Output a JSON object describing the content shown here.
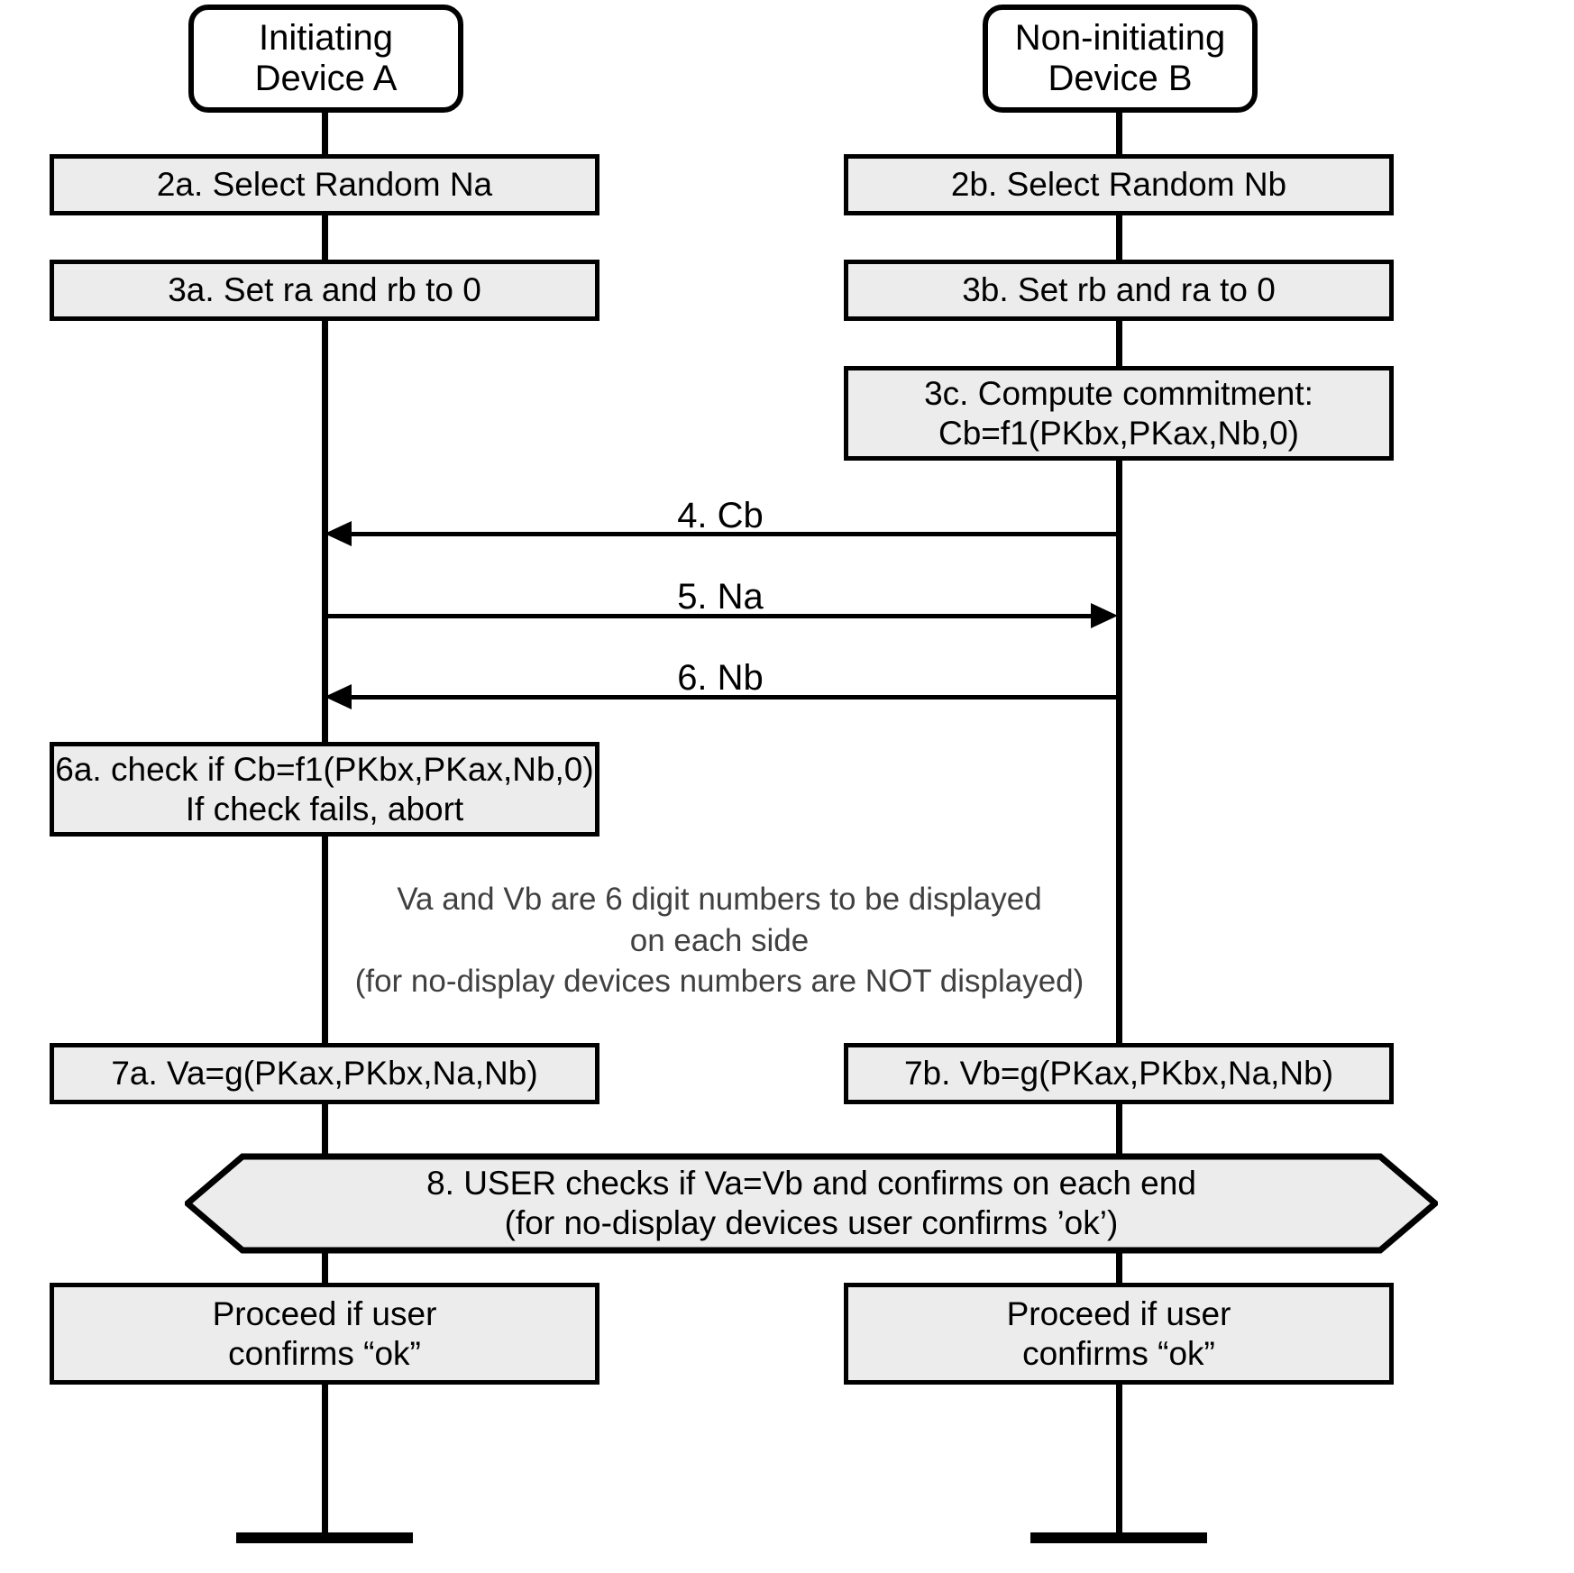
{
  "diagram": {
    "title_left": "Initiating\nDevice A",
    "lifelines": [
      {
        "name": "device-a",
        "label_line1": "Initiating",
        "label_line2": "Device A"
      },
      {
        "name": "device-b",
        "label_line1": "Non-initiating",
        "label_line2": "Device B"
      }
    ],
    "colors": {
      "box_fill": "#ececec",
      "stroke": "#000000",
      "note_text": "#404040",
      "background": "#ffffff"
    }
  },
  "steps": {
    "s2a": {
      "line1": "2a.  Select Random Na"
    },
    "s2b": {
      "line1": "2b.  Select Random Nb"
    },
    "s3a": {
      "line1": "3a.  Set ra and rb to 0"
    },
    "s3b": {
      "line1": "3b.  Set rb and ra to 0"
    },
    "s3c": {
      "line1": "3c.  Compute commitment:",
      "line2": "Cb=f1(PKbx,PKax,Nb,0)"
    },
    "s6a": {
      "line1": "6a.  check if Cb=f1(PKbx,PKax,Nb,0)",
      "line2": "If check fails, abort"
    },
    "s7a": {
      "line1": "7a.  Va=g(PKax,PKbx,Na,Nb)"
    },
    "s7b": {
      "line1": "7b.  Vb=g(PKax,PKbx,Na,Nb)"
    },
    "s8": {
      "line1": "8.  USER checks if Va=Vb and confirms on each end",
      "line2": "(for no-display devices user confirms ’ok’)"
    },
    "proceed_a": {
      "line1": "Proceed if user",
      "line2": "confirms “ok”"
    },
    "proceed_b": {
      "line1": "Proceed if user",
      "line2": "confirms “ok”"
    }
  },
  "messages": [
    {
      "id": "m4",
      "label": "4.  Cb",
      "direction": "b-to-a"
    },
    {
      "id": "m5",
      "label": "5.  Na",
      "direction": "a-to-b"
    },
    {
      "id": "m6",
      "label": "6.  Nb",
      "direction": "b-to-a"
    }
  ],
  "note": {
    "line1": "Va and Vb are 6 digit numbers to be displayed",
    "line2": "on each side",
    "line3": "(for no-display devices numbers are NOT displayed)"
  }
}
